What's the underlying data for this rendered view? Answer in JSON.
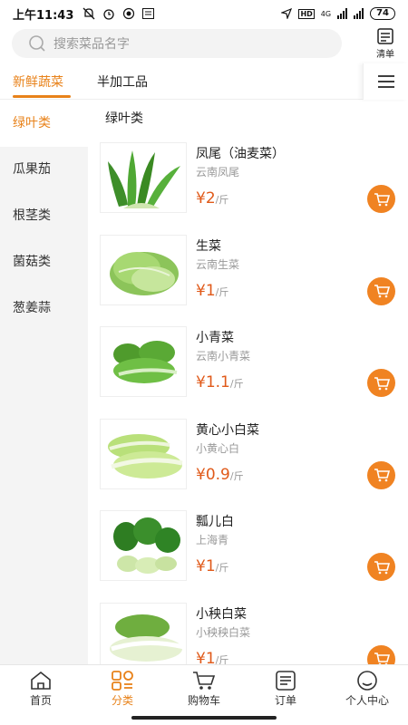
{
  "status_bar": {
    "time": "上午11:43",
    "network_label": "4G",
    "battery": "74",
    "hd_label": "HD"
  },
  "header": {
    "search_placeholder": "搜索菜品名字",
    "list_label": "清单"
  },
  "tabs": [
    {
      "label": "新鲜蔬菜",
      "active": true
    },
    {
      "label": "半加工品",
      "active": false
    }
  ],
  "sidebar": {
    "items": [
      {
        "label": "绿叶类",
        "active": true
      },
      {
        "label": "瓜果茄",
        "active": false
      },
      {
        "label": "根茎类",
        "active": false
      },
      {
        "label": "菌菇类",
        "active": false
      },
      {
        "label": "葱姜蒜",
        "active": false
      }
    ]
  },
  "main": {
    "section_title": "绿叶类",
    "products": [
      {
        "name": "凤尾（油麦菜）",
        "sub": "云南凤尾",
        "price": "¥2",
        "unit": "/斤"
      },
      {
        "name": "生菜",
        "sub": "云南生菜",
        "price": "¥1",
        "unit": "/斤"
      },
      {
        "name": "小青菜",
        "sub": "云南小青菜",
        "price": "¥1.1",
        "unit": "/斤"
      },
      {
        "name": "黄心小白菜",
        "sub": "小黄心白",
        "price": "¥0.9",
        "unit": "/斤"
      },
      {
        "name": "瓢儿白",
        "sub": "上海青",
        "price": "¥1",
        "unit": "/斤"
      },
      {
        "name": "小秧白菜",
        "sub": "小秧秧白菜",
        "price": "¥1",
        "unit": "/斤"
      }
    ]
  },
  "bottom_nav": [
    {
      "label": "首页",
      "icon": "home-icon",
      "active": false
    },
    {
      "label": "分类",
      "icon": "category-icon",
      "active": true
    },
    {
      "label": "购物车",
      "icon": "cart-icon",
      "active": false
    },
    {
      "label": "订单",
      "icon": "order-icon",
      "active": false
    },
    {
      "label": "个人中心",
      "icon": "profile-icon",
      "active": false
    }
  ],
  "colors": {
    "accent": "#e8821a",
    "price": "#e05a1a",
    "cart_button": "#f08322"
  }
}
